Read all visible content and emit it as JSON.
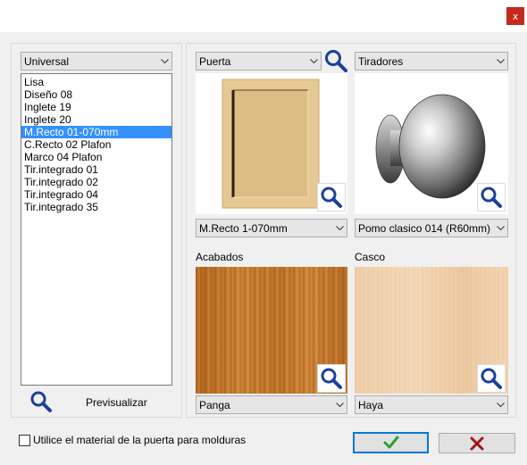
{
  "window": {
    "close_glyph": "x"
  },
  "left": {
    "category_combo": "Universal",
    "list_items": [
      "Lisa",
      "Diseño 08",
      "Inglete 19",
      "Inglete 20",
      "M.Recto 01-070mm",
      "C.Recto 02 Plafon",
      "Marco 04 Plafon",
      "Tir.integrado 01",
      "Tir.integrado 02",
      "Tir.integrado 04",
      "Tir.integrado 35"
    ],
    "selected_index": 4,
    "preview_label": "Previsualizar"
  },
  "right": {
    "door_type_combo": "Puerta",
    "handles_combo": "Tiradores",
    "door_model_combo": "M.Recto 1-070mm",
    "handle_model_combo": "Pomo clasico 014 (R60mm)",
    "finishes_label": "Acabados",
    "finishes_combo": "Panga",
    "carcass_label": "Casco",
    "carcass_combo": "Haya"
  },
  "footer": {
    "checkbox_label": "Utilice el material de la puerta para molduras",
    "checkbox_checked": false,
    "ok_glyph": "✓",
    "cancel_glyph": "✗"
  },
  "colors": {
    "accent": "#0078d7",
    "ok_green": "#2e9e2e",
    "cancel_red": "#a01616",
    "close_red": "#c42b1c",
    "selection": "#3390ff"
  },
  "icons": {
    "zoom": "magnifier-icon",
    "dropdown": "chevron-down-icon"
  }
}
